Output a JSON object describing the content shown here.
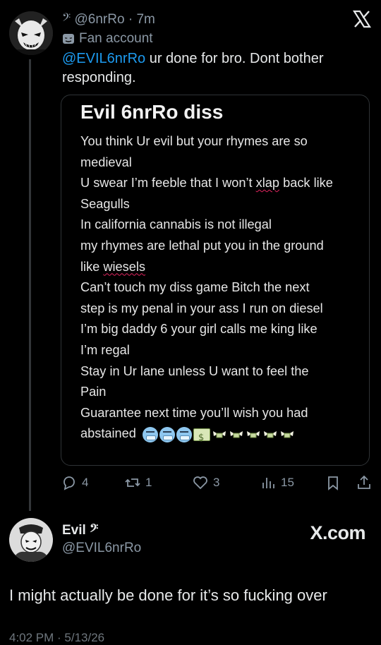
{
  "tweet": {
    "author_symbol": "𝄢",
    "handle": "@6nrRo",
    "separator": " · ",
    "time": "7m",
    "fan_label": "Fan account",
    "mention": "@EVIL6nrRo",
    "text": " ur done for bro. Dont bother responding."
  },
  "card": {
    "title": "Evil 6nrRo diss",
    "lines": [
      "You think Ur evil but your rhymes are so",
      "medieval",
      "U swear I’m feeble that I won’t xlap back like",
      "Seagulls",
      "In california cannabis is not illegal",
      "my rhymes are lethal put you in the ground",
      "like wiesels",
      "Can’t touch my diss game Bitch the next",
      "step is my penal in your ass I run on diesel",
      "I’m big daddy 6 your girl calls me king like",
      "I’m regal",
      "Stay in Ur lane unless U want to feel the",
      "Pain",
      "Guarantee next time you’ll wish you had",
      "abstained"
    ]
  },
  "actions": {
    "replies": "4",
    "retweets": "1",
    "likes": "3",
    "views": "15"
  },
  "reply": {
    "name": "Evil 𝄢",
    "handle": "@EVIL6nrRo",
    "brand": "X.com"
  },
  "quote_text": "I might actually be done for it’s so fucking over",
  "footer": "4:02 PM · 5/13/26",
  "colors": {
    "accent": "#1d9bf0",
    "muted": "#8b98a5",
    "background": "#000000"
  },
  "icons": [
    "x-logo-icon",
    "mask-icon",
    "reply-icon",
    "retweet-icon",
    "like-icon",
    "views-icon",
    "bookmark-icon",
    "share-icon"
  ]
}
